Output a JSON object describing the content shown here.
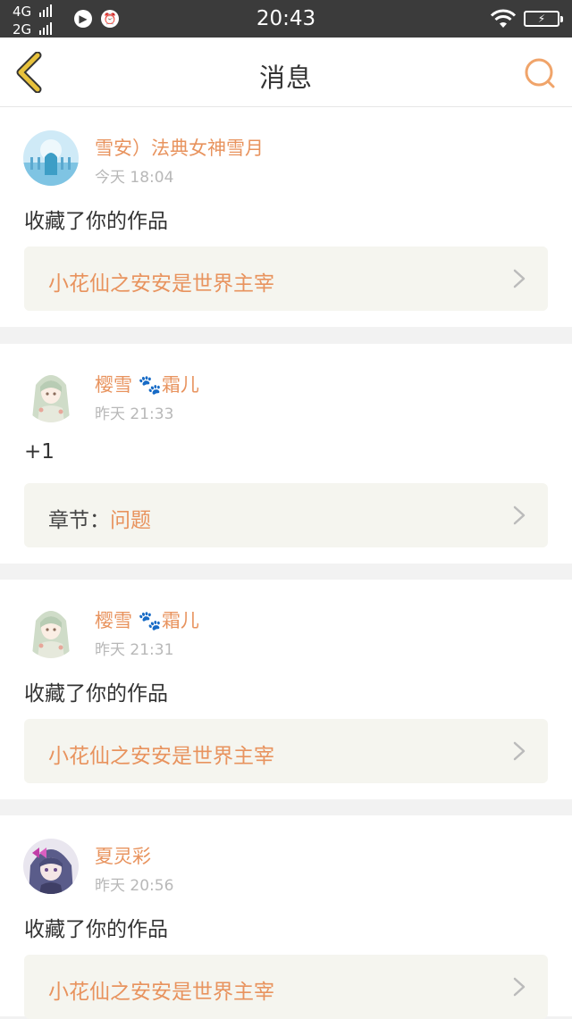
{
  "statusbar": {
    "network1": "4G",
    "network2": "2G",
    "time": "20:43"
  },
  "header": {
    "title": "消息",
    "back_icon": "chevron-left-icon",
    "search_icon": "search-icon"
  },
  "colors": {
    "accent": "#e8935e",
    "nav_icon": "#e0b93a",
    "ref_bg": "#f5f5ef",
    "statusbar": "#3b3b3b"
  },
  "messages": [
    {
      "user": "雪安）法典女神雪月",
      "time": "今天 18:04",
      "text": "收藏了你的作品",
      "ref_prefix": "",
      "ref_title": "小花仙之安安是世界主宰"
    },
    {
      "user": "樱雪 🐾霜儿",
      "time": "昨天 21:33",
      "text": "+1",
      "ref_prefix": "章节：",
      "ref_title": "问题"
    },
    {
      "user": "樱雪 🐾霜儿",
      "time": "昨天 21:31",
      "text": "收藏了你的作品",
      "ref_prefix": "",
      "ref_title": "小花仙之安安是世界主宰"
    },
    {
      "user": "夏灵彩",
      "time": "昨天 20:56",
      "text": "收藏了你的作品",
      "ref_prefix": "",
      "ref_title": "小花仙之安安是世界主宰"
    }
  ]
}
